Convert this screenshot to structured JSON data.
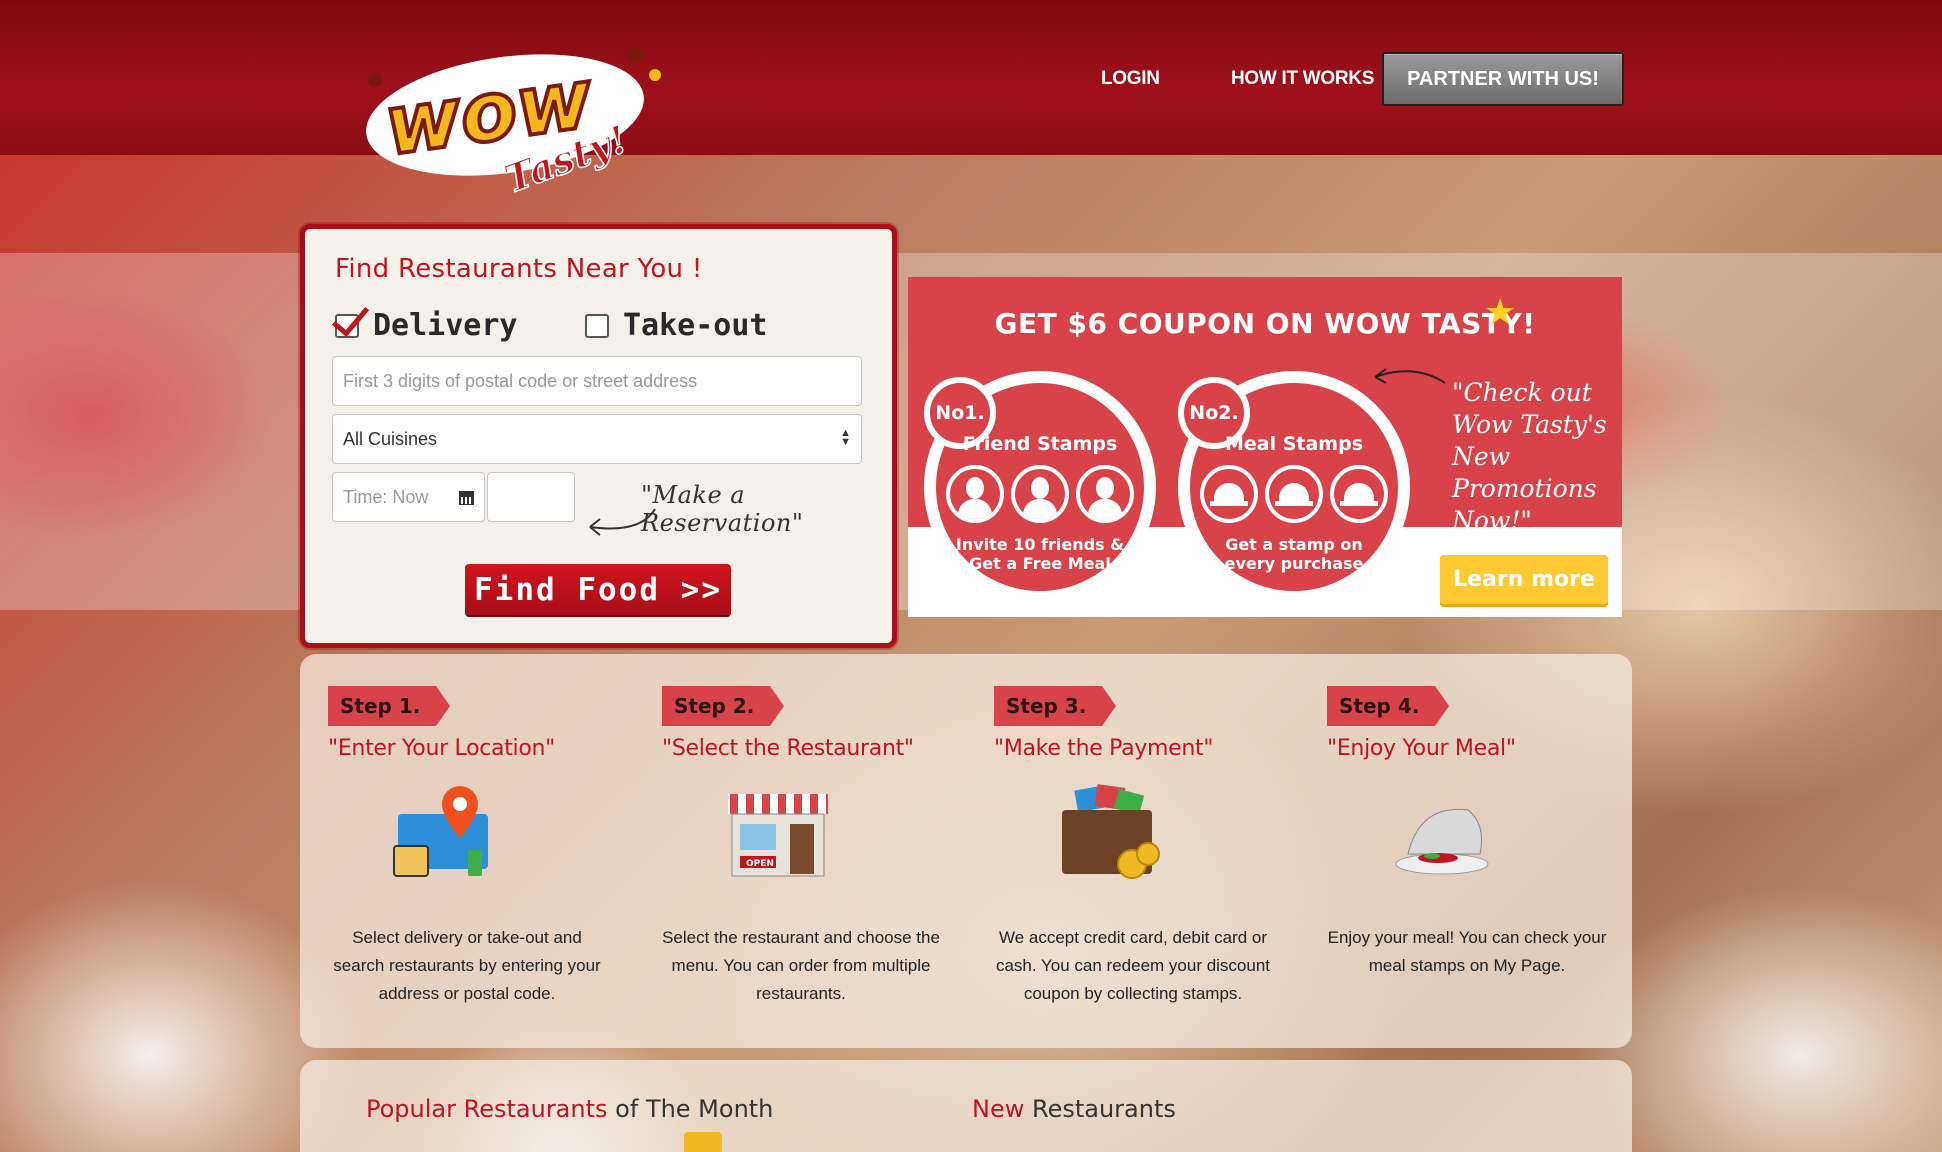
{
  "header": {
    "logo_alt": "Wow Tasty!",
    "nav": {
      "login": "LOGIN",
      "how_it_works": "HOW IT WORKS",
      "partner": "PARTNER WITH US!"
    }
  },
  "search": {
    "title": "Find Restaurants Near You !",
    "delivery_label": "Delivery",
    "delivery_checked": true,
    "takeout_label": "Take-out",
    "takeout_checked": false,
    "address_placeholder": "First 3 digits of postal code or street address",
    "cuisine_selected": "All Cuisines",
    "time_placeholder": "Time: Now",
    "reservation_note": "\"Make a Reservation\"",
    "find_button": "Find Food >>"
  },
  "promo": {
    "title": "GET $6 COUPON ON WOW TASTY!",
    "cards": [
      {
        "tag": "No1.",
        "title": "Friend Stamps",
        "desc_line1": "Invite 10 friends &",
        "desc_line2": "Get a Free Meal",
        "icon": "person-icon"
      },
      {
        "tag": "No2.",
        "title": "Meal Stamps",
        "desc_line1": "Get a stamp on",
        "desc_line2": "every purchase",
        "icon": "cloche-icon"
      }
    ],
    "quote": "\"Check out Wow Tasty's New Promotions Now!\"",
    "learn_more": "Learn more",
    "colors": {
      "primary": "#d8434a",
      "button": "#ffc933"
    }
  },
  "steps": [
    {
      "tag": "Step 1.",
      "title": "\"Enter Your Location\"",
      "icon": "location-icon",
      "desc": "Select delivery or take-out and search restaurants by entering your address or postal code."
    },
    {
      "tag": "Step 2.",
      "title": "\"Select the Restaurant\"",
      "icon": "storefront-icon",
      "desc": "Select the restaurant and choose the menu. You can order from multiple restaurants."
    },
    {
      "tag": "Step 3.",
      "title": "\"Make the Payment\"",
      "icon": "wallet-icon",
      "desc": "We accept credit card, debit card or cash. You can redeem your discount coupon by collecting stamps."
    },
    {
      "tag": "Step 4.",
      "title": "\"Enjoy Your Meal\"",
      "icon": "meal-plate-icon",
      "desc": "Enjoy your meal! You can check your meal stamps on My Page."
    }
  ],
  "restaurants": {
    "popular_red": "Popular Restaurants",
    "popular_rest": " of The Month",
    "new_red": "New",
    "new_rest": " Restaurants"
  },
  "colors": {
    "header": "#a0101a",
    "accent": "#c0141e"
  }
}
